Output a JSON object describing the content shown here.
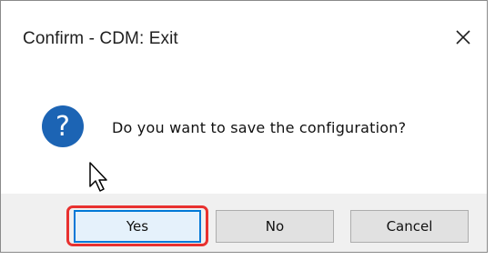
{
  "dialog": {
    "title": "Confirm - CDM: Exit",
    "message": "Do you want to save the configuration?",
    "icon": "question-icon",
    "close_icon": "close-icon"
  },
  "buttons": {
    "yes_label": "Yes",
    "no_label": "No",
    "cancel_label": "Cancel"
  },
  "colors": {
    "icon_blue": "#1c64b4",
    "highlight_red": "#e8312f",
    "focus_blue": "#0078d7",
    "footer_bg": "#f0f0f0"
  }
}
